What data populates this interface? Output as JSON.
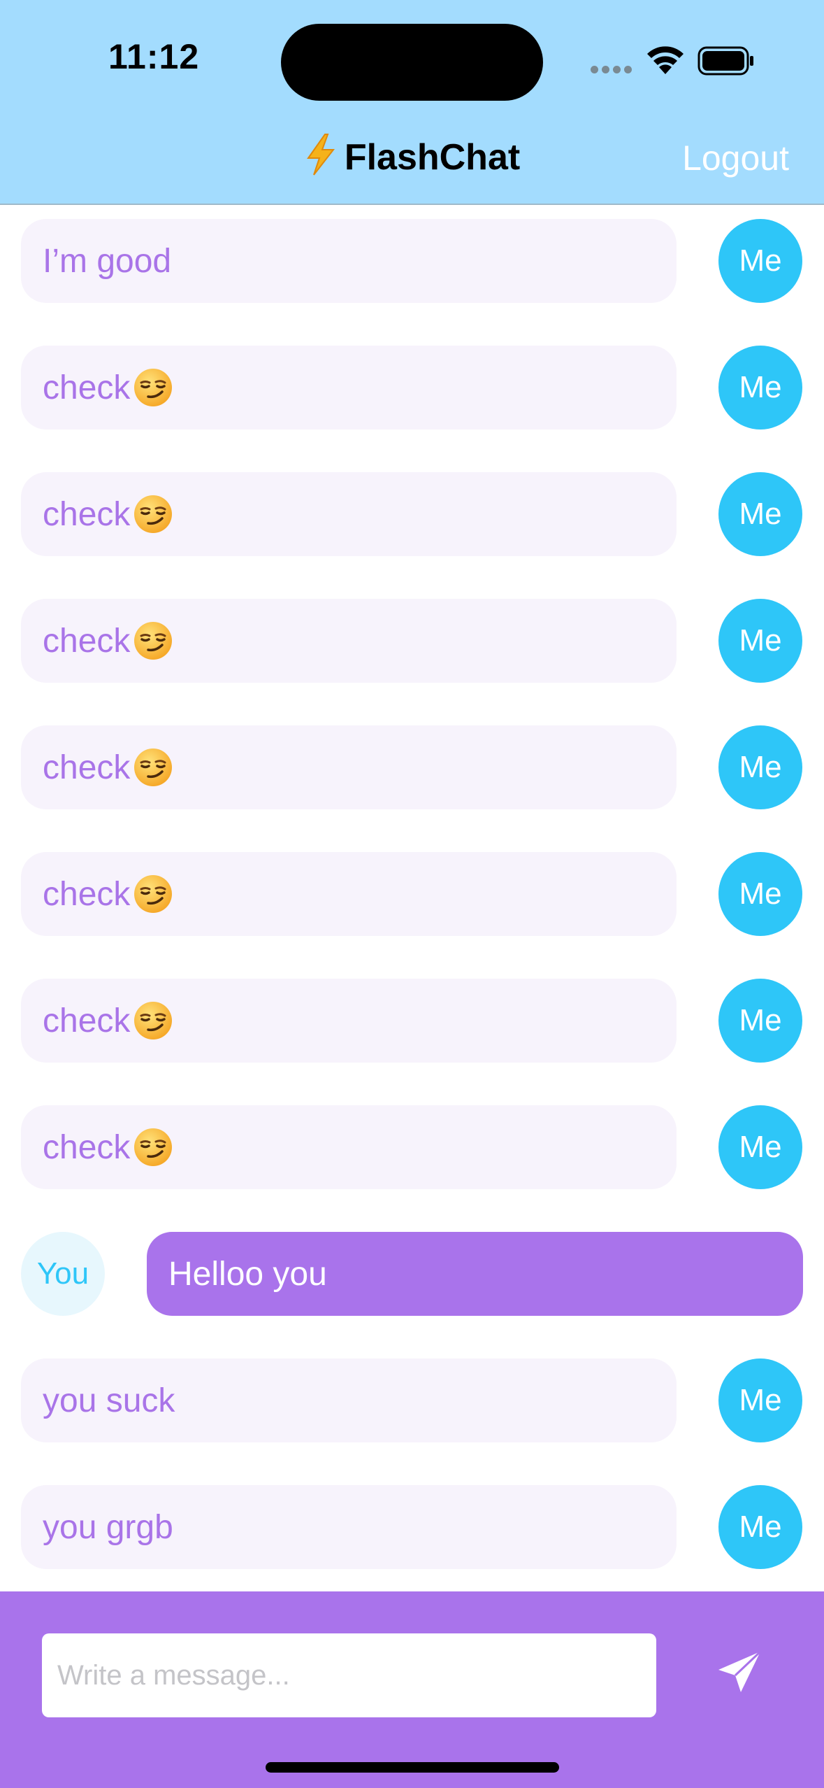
{
  "status_bar": {
    "time": "11:12"
  },
  "nav": {
    "title": "FlashChat",
    "title_icon": "lightning-bolt-icon",
    "logout_label": "Logout"
  },
  "messages": [
    {
      "sender": "me",
      "avatar": "Me",
      "text": "I’m good",
      "emoji": ""
    },
    {
      "sender": "me",
      "avatar": "Me",
      "text": "check",
      "emoji": "smirking-face"
    },
    {
      "sender": "me",
      "avatar": "Me",
      "text": "check",
      "emoji": "smirking-face"
    },
    {
      "sender": "me",
      "avatar": "Me",
      "text": "check",
      "emoji": "smirking-face"
    },
    {
      "sender": "me",
      "avatar": "Me",
      "text": "check",
      "emoji": "smirking-face"
    },
    {
      "sender": "me",
      "avatar": "Me",
      "text": "check",
      "emoji": "smirking-face"
    },
    {
      "sender": "me",
      "avatar": "Me",
      "text": "check",
      "emoji": "smirking-face"
    },
    {
      "sender": "me",
      "avatar": "Me",
      "text": "check",
      "emoji": "smirking-face"
    },
    {
      "sender": "you",
      "avatar": "You",
      "text": "Helloo you",
      "emoji": ""
    },
    {
      "sender": "me",
      "avatar": "Me",
      "text": "you suck",
      "emoji": ""
    },
    {
      "sender": "me",
      "avatar": "Me",
      "text": "you grgb",
      "emoji": ""
    }
  ],
  "composer": {
    "placeholder": "Write a message...",
    "value": "",
    "send_icon": "paper-plane-icon"
  },
  "colors": {
    "header_bg": "#a3dcfe",
    "footer_bg": "#a973eb",
    "my_bubble_bg": "#f7f3fc",
    "my_text": "#a974e8",
    "my_avatar_bg": "#2ec6f8",
    "their_bubble_bg": "#a973eb",
    "their_avatar_bg": "#e7f7fd"
  }
}
